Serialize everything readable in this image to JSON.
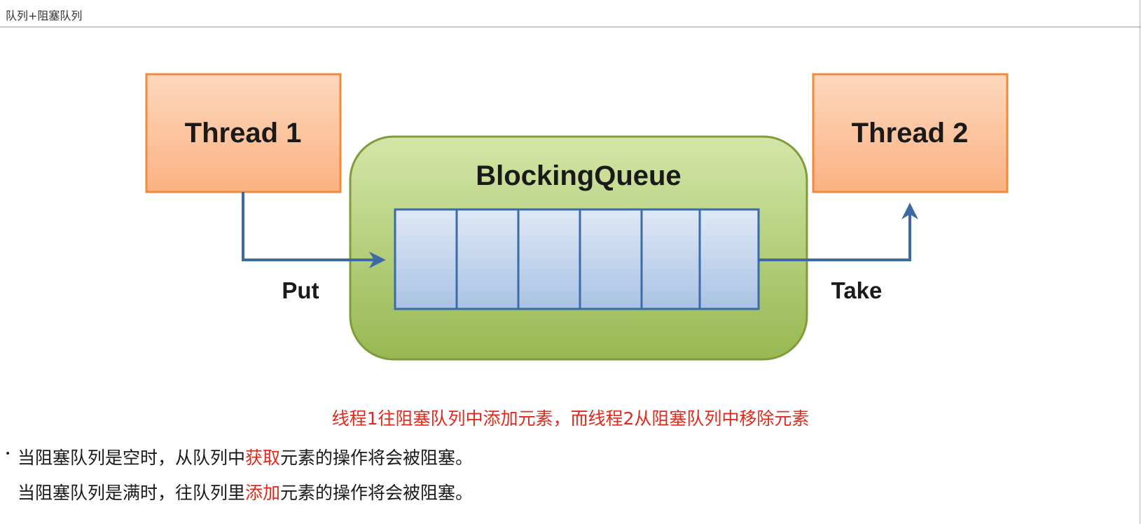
{
  "page": {
    "title": "队列+阻塞队列"
  },
  "diagram": {
    "thread1": "Thread 1",
    "thread2": "Thread 2",
    "queue": "BlockingQueue",
    "put": "Put",
    "take": "Take",
    "slot_count": 6,
    "colors": {
      "thread_fill": "#fbc39a",
      "thread_border": "#f08a3c",
      "queue_fill": "#a9c46a",
      "queue_border": "#7f9c3a",
      "slot_fill": "#c3d6ee",
      "slot_border": "#3b6ba8",
      "arrow": "#3e6aa4"
    }
  },
  "caption": "线程1往阻塞队列中添加元素，而线程2从阻塞队列中移除元素",
  "notes": [
    {
      "before": "当阻塞队列是空时，从队列中",
      "highlight": "获取",
      "after": "元素的操作将会被阻塞。"
    },
    {
      "before": "当阻塞队列是满时，往队列里",
      "highlight": "添加",
      "after": "元素的操作将会被阻塞。"
    }
  ]
}
